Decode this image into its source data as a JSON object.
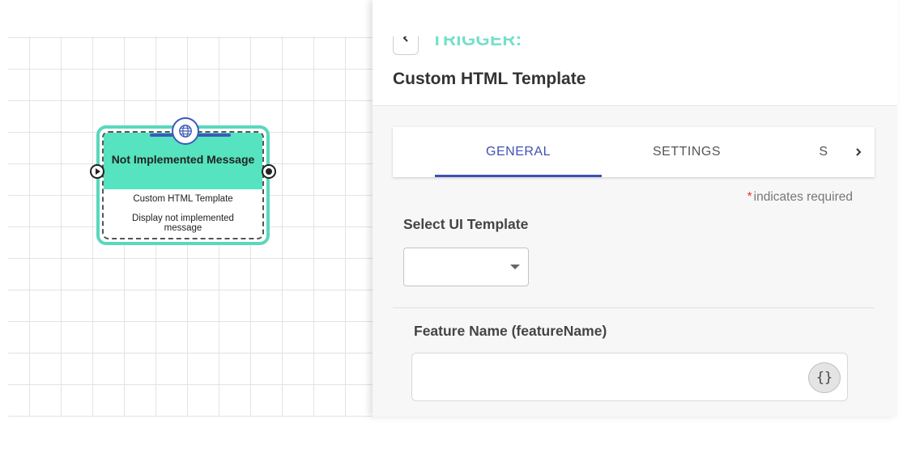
{
  "node": {
    "title": "Not Implemented Message",
    "type_label": "Custom HTML Template",
    "description": "Display not implemented message",
    "icon": "globe-icon",
    "accent_color": "#5ad8bd",
    "header_color": "#55e3c0"
  },
  "panel": {
    "heading": "TRIGGER:",
    "title": "Custom HTML Template",
    "back_icon": "chevron-left-icon",
    "tabs": [
      {
        "label": "GENERAL",
        "active": true
      },
      {
        "label": "SETTINGS",
        "active": false
      },
      {
        "label": "S",
        "active": false
      }
    ],
    "tabs_next_icon": "chevron-right-icon",
    "required_note": {
      "star": "*",
      "text": "indicates required"
    },
    "select_ui_template": {
      "label": "Select UI Template",
      "value": ""
    },
    "feature_name": {
      "label": "Feature Name (featureName)",
      "value": "",
      "expression_button": "{}"
    }
  },
  "colors": {
    "tab_active": "#3f51b5",
    "trigger_heading": "#74e0c8",
    "required_star": "#e53935"
  }
}
